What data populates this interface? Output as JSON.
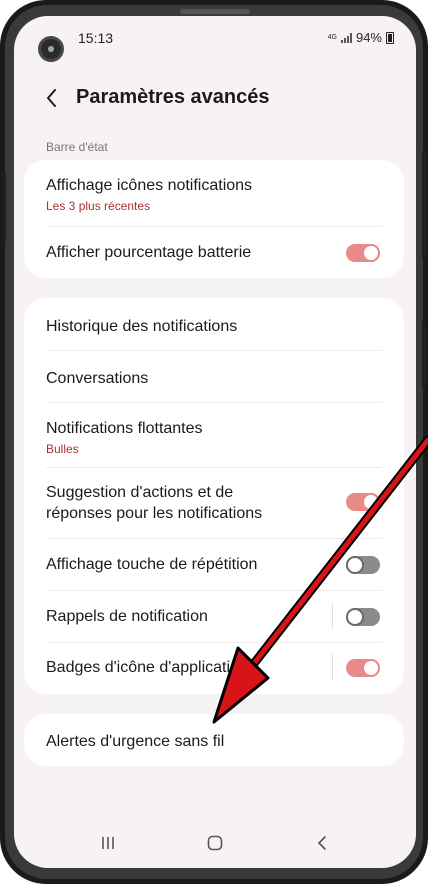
{
  "status_bar": {
    "time": "15:13",
    "network": "4G",
    "battery": "94%"
  },
  "header": {
    "title": "Paramètres avancés",
    "back_icon": "chevron-left-icon"
  },
  "section": {
    "label": "Barre d'état"
  },
  "card1": {
    "items": [
      {
        "title": "Affichage icônes notifications",
        "subtitle": "Les 3 plus récentes"
      },
      {
        "title": "Afficher pourcentage batterie",
        "toggle": true
      }
    ]
  },
  "card2": {
    "items": [
      {
        "title": "Historique des notifications"
      },
      {
        "title": "Conversations"
      },
      {
        "title": "Notifications flottantes",
        "subtitle": "Bulles"
      },
      {
        "title": "Suggestion d'actions et de",
        "title2": "réponses pour les notifications",
        "toggle": true
      },
      {
        "title": "Affichage touche de répétition",
        "toggle": false
      },
      {
        "title": "Rappels de notification",
        "toggle": false
      },
      {
        "title": "Badges d'icône d'application",
        "toggle": true
      }
    ]
  },
  "card3": {
    "items": [
      {
        "title": "Alertes d'urgence sans fil"
      }
    ]
  },
  "navbar": {
    "recents_icon": "recents-icon",
    "home_icon": "home-icon",
    "back_icon": "back-icon"
  },
  "colors": {
    "accent": "#e88a88",
    "subtitle": "#a8322d",
    "background": "#f7f3f2",
    "arrow": "#d81418"
  }
}
